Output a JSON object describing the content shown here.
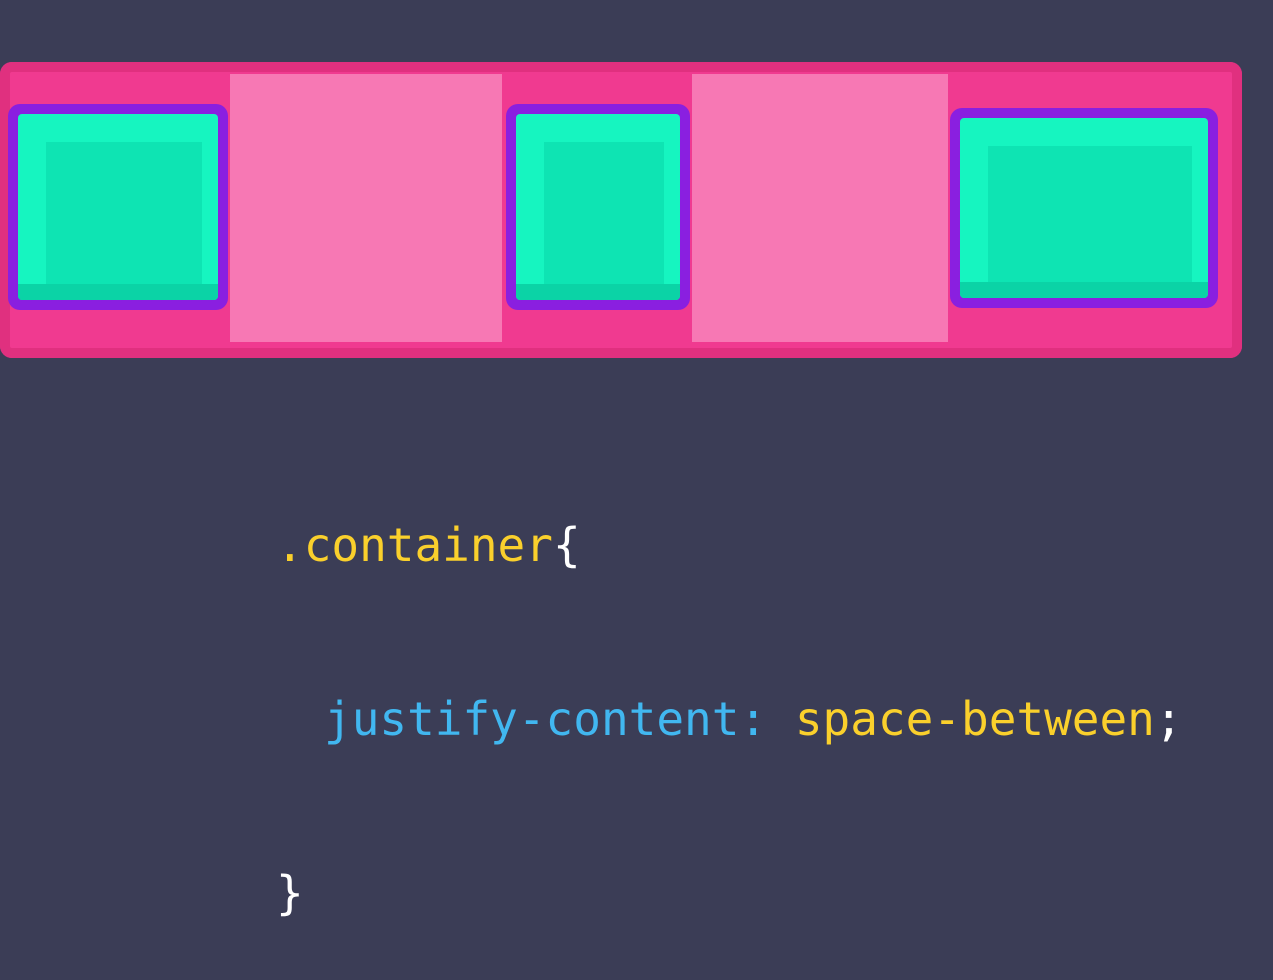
{
  "diagram": {
    "items": [
      {
        "id": "item-1"
      },
      {
        "id": "item-2"
      },
      {
        "id": "item-3"
      }
    ],
    "gaps": [
      {
        "id": "gap-1"
      },
      {
        "id": "gap-2"
      }
    ],
    "colors": {
      "background": "#3b3d56",
      "container": "#f03a90",
      "gap_highlight": "#f778b4",
      "item_border": "#8a1fe0",
      "item_face": "#16f5c0"
    }
  },
  "code": {
    "selector": ".container",
    "open_brace": "{",
    "property": "justify-content",
    "colon": ":",
    "value": "space-between",
    "semicolon": ";",
    "close_brace": "}"
  }
}
